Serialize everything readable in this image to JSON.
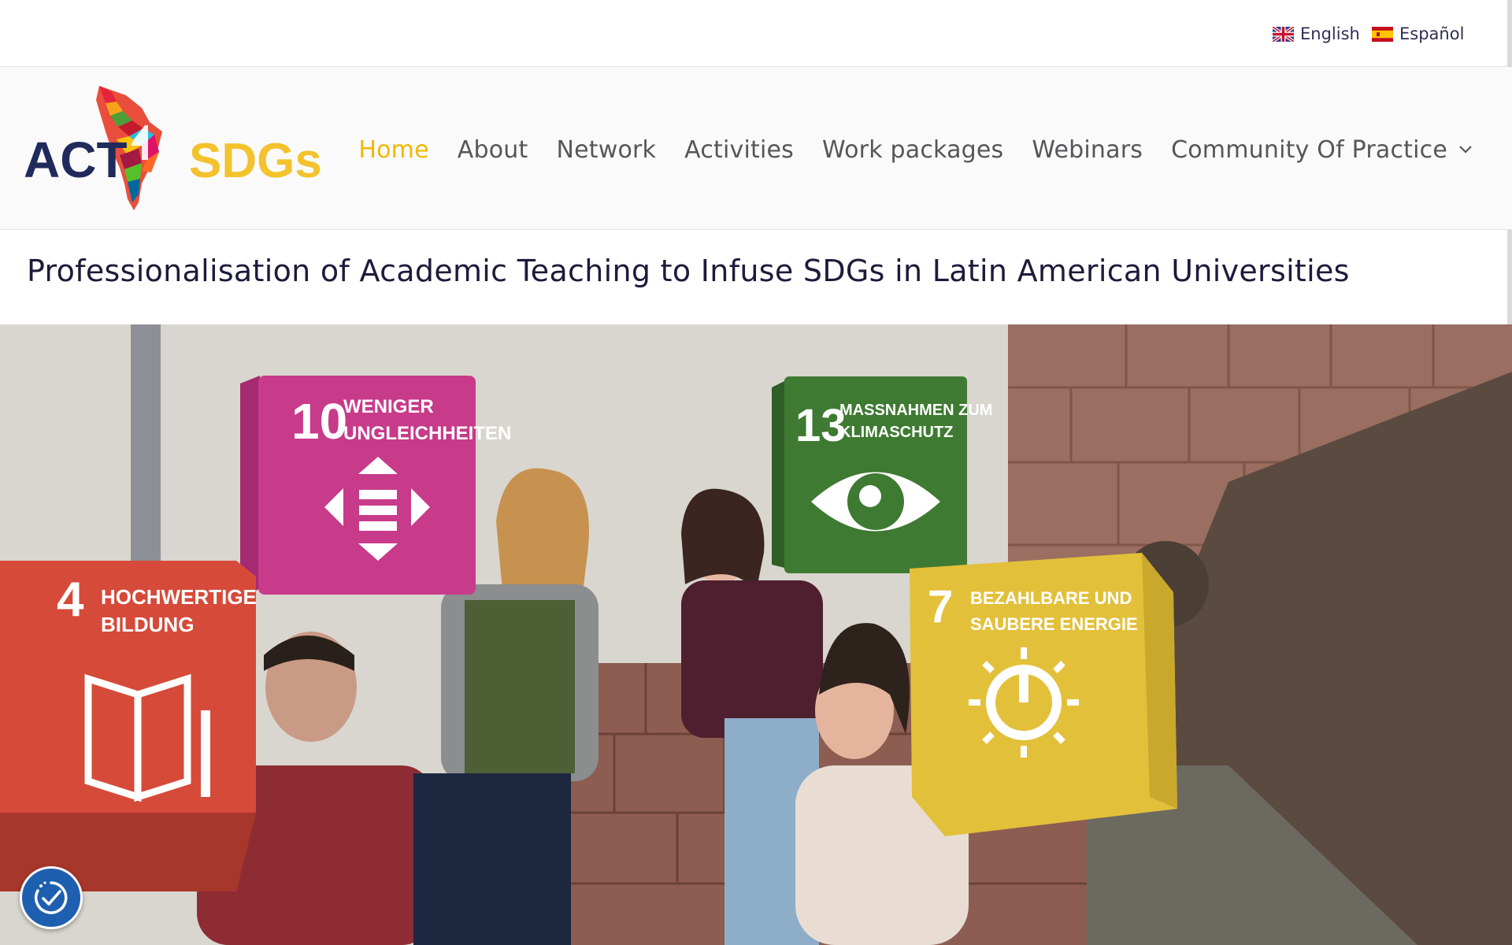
{
  "languages": [
    {
      "label": "English",
      "flag": "uk-flag-icon"
    },
    {
      "label": "Español",
      "flag": "spain-flag-icon"
    }
  ],
  "logo": {
    "text_left": "ACT",
    "text_right": "SDGs",
    "mark": "4",
    "colors": {
      "dark": "#1f2b5b",
      "yellow": "#f3c22c"
    }
  },
  "nav": {
    "items": [
      {
        "label": "Home",
        "active": true
      },
      {
        "label": "About"
      },
      {
        "label": "Network"
      },
      {
        "label": "Activities"
      },
      {
        "label": "Work packages"
      },
      {
        "label": "Webinars"
      },
      {
        "label": "Community Of Practice",
        "has_dropdown": true
      }
    ],
    "active_color": "#f2b800"
  },
  "tagline": "Professionalisation of Academic Teaching to Infuse SDGs in Latin American Universities",
  "hero": {
    "cubes": [
      {
        "number": "4",
        "title": "HOCHWERTIGE\nBILDUNG",
        "color": "#d64a3a",
        "icon": "book-icon"
      },
      {
        "number": "10",
        "title": "WENIGER\nUNGLEICHHEITEN",
        "color": "#c83a8a",
        "icon": "equality-arrows-icon"
      },
      {
        "number": "13",
        "title": "MASSNAHMEN ZUM\nKLIMASCHUTZ",
        "color": "#3e7a32",
        "icon": "eye-globe-icon"
      },
      {
        "number": "7",
        "title": "BEZAHLBARE UND\nSAUBERE ENERGIE",
        "color": "#e3c03a",
        "icon": "sun-power-icon"
      }
    ]
  },
  "accessibility": {
    "icon": "accessibility-check-icon"
  }
}
